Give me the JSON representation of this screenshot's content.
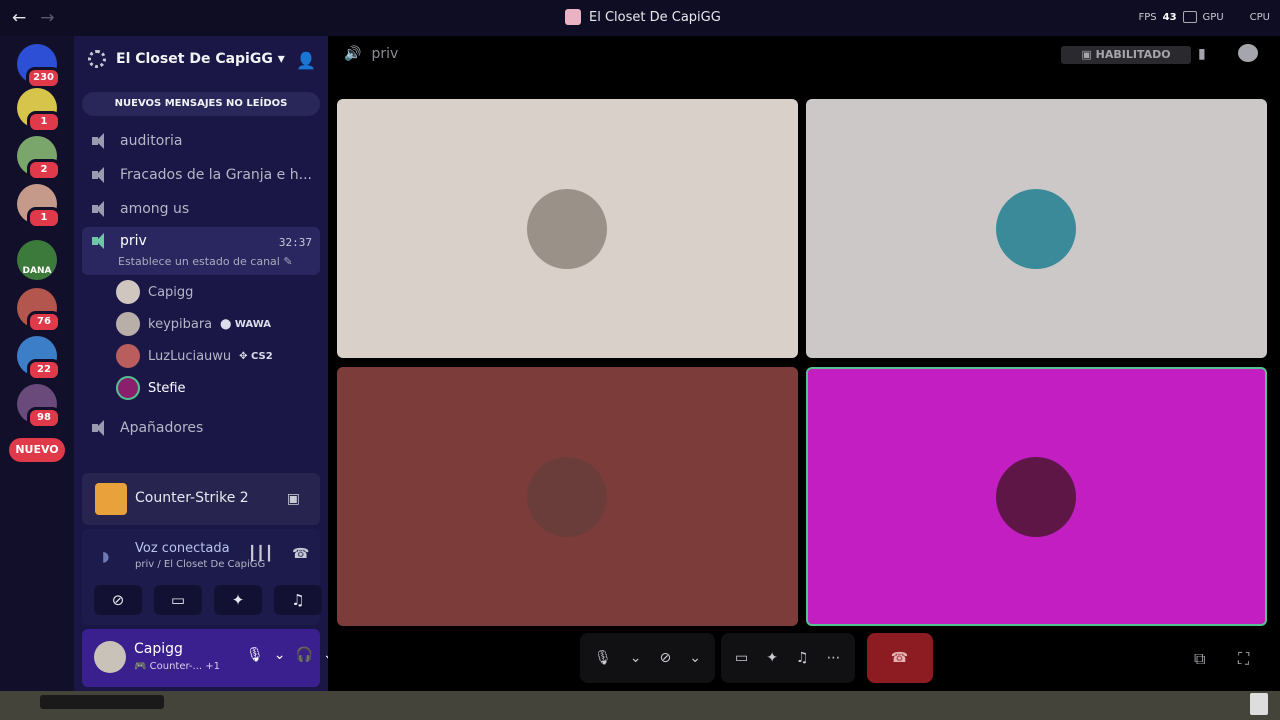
{
  "window": {
    "title": "El Closet De CapiGG",
    "back_icon": "←",
    "forward_icon": "→",
    "perf": {
      "fps_label": "FPS",
      "fps_value": "43",
      "gpu_label": "GPU",
      "cpu_label": "CPU"
    }
  },
  "rail": {
    "badges": [
      "230",
      "1",
      "2",
      "1",
      "76",
      "22",
      "98"
    ],
    "dana_label": "DANA",
    "new_label": "NUEVO",
    "colors": [
      "#2c4fd6",
      "#d6c54a",
      "#7aa66c",
      "#c69a8a",
      "#3c7a3c",
      "#b3564e",
      "#3d7ec8",
      "#6a4a7a"
    ]
  },
  "server": {
    "name": "El Closet De CapiGG",
    "chevron": "▾",
    "unread_label": "NUEVOS MENSAJES NO LEÍDOS"
  },
  "channels": [
    {
      "name": "auditoria"
    },
    {
      "name": "Fracados de la Granja e h..."
    },
    {
      "name": "among us"
    }
  ],
  "active_channel": {
    "name": "priv",
    "timer": "32:37",
    "status": "Establece un estado de canal ✎",
    "members": [
      {
        "name": "Capigg",
        "activity": "",
        "color": "#cfc7bf"
      },
      {
        "name": "keypibara",
        "activity": "⬤ WAWA",
        "color": "#b8b0a8"
      },
      {
        "name": "LuzLuciauwu",
        "activity": "✥ CS2",
        "color": "#b95d5d"
      },
      {
        "name": "Stefie",
        "activity": "",
        "color": "#8a1f6e"
      }
    ]
  },
  "channels_after": [
    {
      "name": "Apañadores"
    }
  ],
  "activity": {
    "game": "Counter-Strike 2"
  },
  "voice": {
    "status": "Voz conectada",
    "location": "priv / El Closet De CapiGG"
  },
  "user": {
    "name": "Capigg",
    "status": "🎮 Counter-... +1"
  },
  "main": {
    "channel": "priv",
    "enabled_label": "▣ HABILITADO",
    "tiles": [
      {
        "bg": "#d8d0c9",
        "avatar": "#9a9188"
      },
      {
        "bg": "#cdc8c8",
        "avatar": "#3a8a9a"
      },
      {
        "bg": "#7c3d3a",
        "avatar": "#6a3d3a"
      },
      {
        "bg": "#c21ec2",
        "avatar": "#5e1646"
      }
    ]
  }
}
